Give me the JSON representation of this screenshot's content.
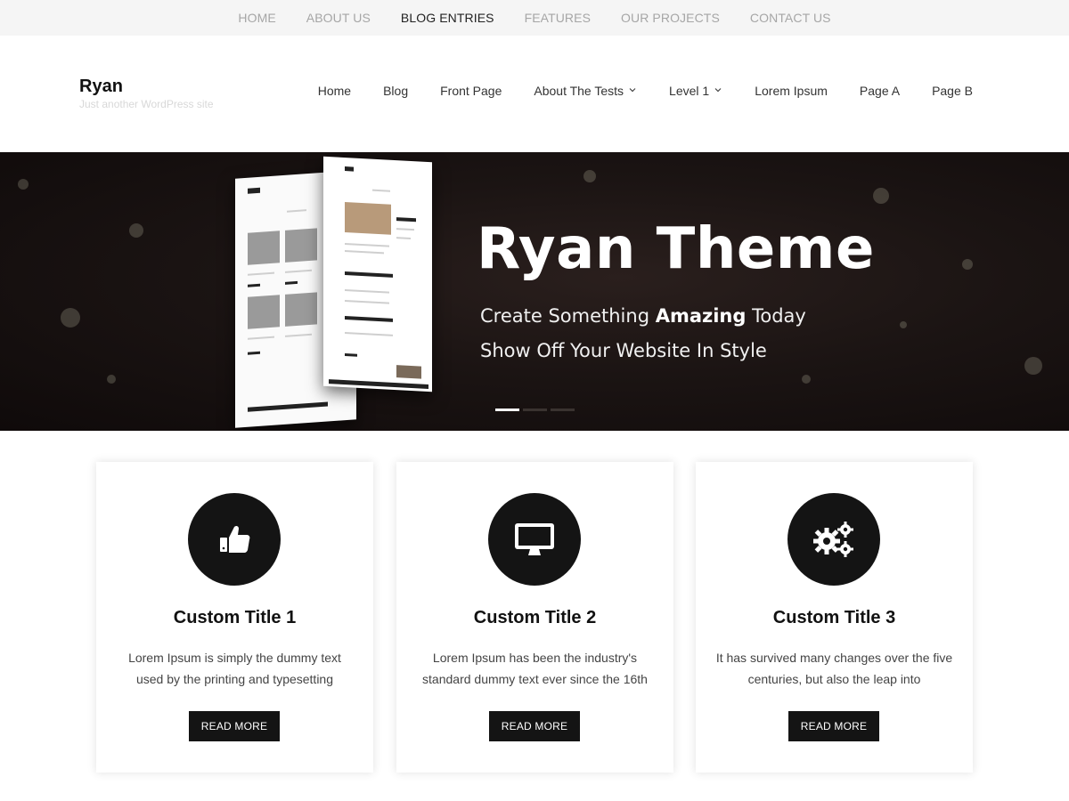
{
  "topbar": {
    "items": [
      {
        "label": "HOME"
      },
      {
        "label": "ABOUT US"
      },
      {
        "label": "BLOG ENTRIES",
        "active": true
      },
      {
        "label": "FEATURES"
      },
      {
        "label": "OUR PROJECTS"
      },
      {
        "label": "CONTACT US"
      }
    ]
  },
  "site": {
    "title": "Ryan",
    "tagline": "Just another WordPress site"
  },
  "main_nav": {
    "items": [
      {
        "label": "Home"
      },
      {
        "label": "Blog"
      },
      {
        "label": "Front Page"
      },
      {
        "label": "About The Tests",
        "has_dropdown": true
      },
      {
        "label": "Level 1",
        "has_dropdown": true
      },
      {
        "label": "Lorem Ipsum"
      },
      {
        "label": "Page A"
      },
      {
        "label": "Page B"
      }
    ]
  },
  "hero": {
    "title": "Ryan Theme",
    "line1_pre": "Create Something ",
    "line1_bold": "Amazing",
    "line1_post": " Today",
    "line2": "Show Off Your Website In Style",
    "slides_total": 3,
    "active_slide": 1
  },
  "cards": [
    {
      "icon": "thumbs-up-icon",
      "title": "Custom Title 1",
      "text": "Lorem Ipsum is simply the dummy text used by the printing and typesetting",
      "button": "READ MORE"
    },
    {
      "icon": "monitor-icon",
      "title": "Custom Title 2",
      "text": "Lorem Ipsum has been the industry's standard dummy text ever since the 16th",
      "button": "READ MORE"
    },
    {
      "icon": "gears-icon",
      "title": "Custom Title 3",
      "text": "It has survived many changes over the five centuries, but also the leap into",
      "button": "READ MORE"
    }
  ],
  "colors": {
    "accent_dark": "#141414",
    "topbar_bg": "#f5f5f5",
    "topbar_text": "#a6a6a6",
    "hero_bg": "#1b1413"
  }
}
